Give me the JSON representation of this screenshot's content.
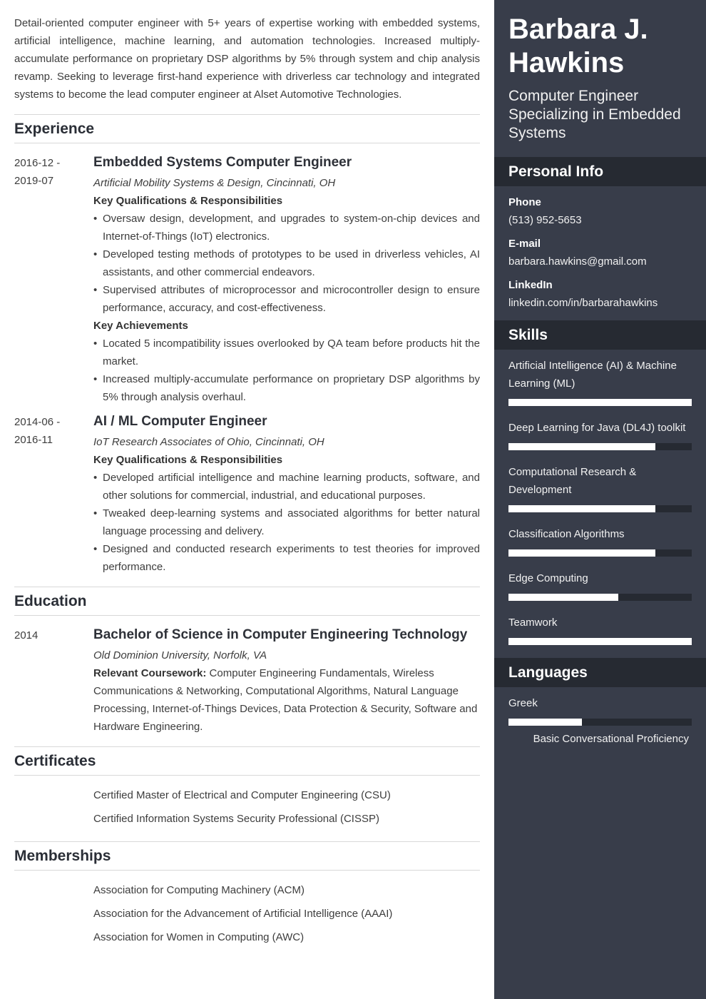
{
  "summary": "Detail-oriented computer engineer with 5+ years of expertise working with embedded systems, artificial intelligence, machine learning, and automation technologies. Increased multiply-accumulate performance on proprietary DSP algorithms by 5% through system and chip analysis revamp. Seeking to leverage first-hand experience with driverless car technology and integrated systems to become the lead computer engineer at Alset Automotive Technologies.",
  "experience": {
    "title": "Experience",
    "jobs": [
      {
        "date_start": "2016-12 -",
        "date_end": "2019-07",
        "title": "Embedded Systems Computer Engineer",
        "company": "Artificial Mobility Systems & Design, Cincinnati, OH",
        "qual_label": "Key Qualifications & Responsibilities",
        "qualifications": [
          "Oversaw design, development, and upgrades to system-on-chip devices and Internet-of-Things (IoT) electronics.",
          "Developed testing methods of prototypes to be used in driverless vehicles, AI assistants, and other commercial endeavors.",
          "Supervised attributes of microprocessor and microcontroller design to ensure performance, accuracy, and cost-effectiveness."
        ],
        "ach_label": "Key Achievements",
        "achievements": [
          "Located 5 incompatibility issues overlooked by QA team before products hit the market.",
          "Increased multiply-accumulate performance on proprietary DSP algorithms by 5% through analysis overhaul."
        ]
      },
      {
        "date_start": "2014-06 -",
        "date_end": "2016-11",
        "title": "AI / ML Computer Engineer",
        "company": "IoT Research Associates of Ohio, Cincinnati, OH",
        "qual_label": "Key Qualifications & Responsibilities",
        "qualifications": [
          "Developed artificial intelligence and machine learning products, software, and other solutions for commercial, industrial, and educational purposes.",
          "Tweaked deep-learning systems and associated algorithms for better natural language processing and delivery.",
          "Designed and conducted research experiments to test theories for improved performance."
        ]
      }
    ]
  },
  "education": {
    "title": "Education",
    "date": "2014",
    "degree": "Bachelor of Science in Computer Engineering Technology",
    "school": "Old Dominion University, Norfolk, VA",
    "course_label": "Relevant Coursework:",
    "coursework": " Computer Engineering Fundamentals, Wireless Communications & Networking, Computational Algorithms, Natural Language Processing, Internet-of-Things Devices, Data Protection & Security, Software and Hardware Engineering."
  },
  "certificates": {
    "title": "Certificates",
    "items": [
      "Certified Master of Electrical and Computer Engineering (CSU)",
      "Certified Information Systems Security Professional (CISSP)"
    ]
  },
  "memberships": {
    "title": "Memberships",
    "items": [
      "Association for Computing Machinery (ACM)",
      "Association for the Advancement of Artificial Intelligence (AAAI)",
      "Association for Women in Computing (AWC)"
    ]
  },
  "sidebar": {
    "name": "Barbara J. Hawkins",
    "headline": "Computer Engineer Specializing in Embedded Systems",
    "personal_info": {
      "title": "Personal Info",
      "phone_label": "Phone",
      "phone": "(513) 952-5653",
      "email_label": "E-mail",
      "email": "barbara.hawkins@gmail.com",
      "linkedin_label": "LinkedIn",
      "linkedin": "linkedin.com/in/barbarahawkins"
    },
    "skills": {
      "title": "Skills",
      "items": [
        {
          "name": "Artificial Intelligence (AI) & Machine Learning (ML)",
          "level": 1.0
        },
        {
          "name": "Deep Learning for Java (DL4J) toolkit",
          "level": 0.8
        },
        {
          "name": "Computational Research & Development",
          "level": 0.8
        },
        {
          "name": "Classification Algorithms",
          "level": 0.8
        },
        {
          "name": "Edge Computing",
          "level": 0.6
        },
        {
          "name": "Teamwork",
          "level": 1.0
        }
      ]
    },
    "languages": {
      "title": "Languages",
      "items": [
        {
          "name": "Greek",
          "level": 0.4,
          "level_label": "Basic Conversational Proficiency"
        }
      ]
    }
  },
  "colors": {
    "sidebar_bg": "#383d4a",
    "sidebar_header_bg": "#262a32",
    "bar_fill": "#ffffff"
  }
}
